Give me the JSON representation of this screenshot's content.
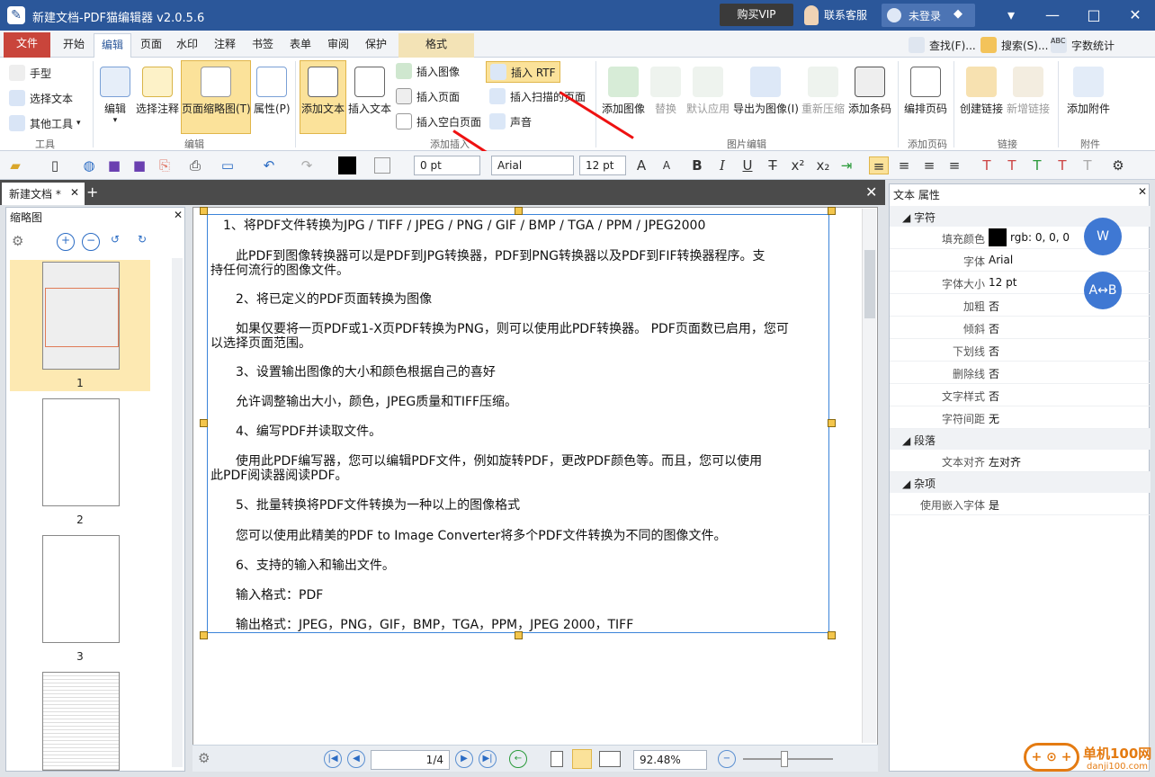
{
  "titlebar": {
    "title": "新建文档-PDF猫编辑器 v2.0.5.6",
    "vip_button": "购买VIP",
    "service": "联系客服",
    "login": "未登录"
  },
  "menu_tabs": [
    "文件",
    "开始",
    "编辑",
    "页面",
    "水印",
    "注释",
    "书签",
    "表单",
    "审阅",
    "保护",
    "格式"
  ],
  "right_tools": {
    "find": "查找(F)...",
    "search": "搜索(S)...",
    "wordcount": "字数统计"
  },
  "ribbon": {
    "groups": {
      "tools": "工具",
      "edit": "编辑",
      "add_insert": "添加插入",
      "image_edit": "图片编辑",
      "add_pagenum": "添加页码",
      "link": "链接",
      "attachment": "附件"
    },
    "tools": [
      "手型",
      "选择文本",
      "其他工具"
    ],
    "edit_buttons": [
      "编辑",
      "选择注释",
      "页面缩略图(T)",
      "属性(P)"
    ],
    "add_text": "添加文本",
    "insert_text": "插入文本",
    "insert_small": [
      "插入图像",
      "插入页面",
      "插入空白页面"
    ],
    "insert_rtf": [
      "插入 RTF",
      "插入扫描的页面",
      "声音"
    ],
    "image_buttons": [
      "添加图像",
      "替换",
      "默认应用",
      "导出为图像(I)",
      "重新压缩",
      "添加条码"
    ],
    "pagenum": "编排页码",
    "link_buttons": [
      "创建链接",
      "新增链接"
    ],
    "attach": "添加附件"
  },
  "format_toolbar": {
    "stroke": "0 pt",
    "font": "Arial",
    "size": "12 pt"
  },
  "doc_tab": "新建文档 *",
  "thumbs": {
    "title": "缩略图",
    "pages": [
      "1",
      "2",
      "3"
    ]
  },
  "document": {
    "lines": [
      "1、将PDF文件转换为JPG / TIFF / JPEG / PNG / GIF / BMP / TGA / PPM / JPEG2000",
      "此PDF到图像转换器可以是PDF到JPG转换器，PDF到PNG转换器以及PDF到FIF转换器程序。支",
      "持任何流行的图像文件。",
      "2、将已定义的PDF页面转换为图像",
      "如果仅要将一页PDF或1-X页PDF转换为PNG，则可以使用此PDF转换器。 PDF页面数已启用，您可",
      "以选择页面范围。",
      "3、设置输出图像的大小和颜色根据自己的喜好",
      "允许调整输出大小，颜色，JPEG质量和TIFF压缩。",
      "4、编写PDF并读取文件。",
      "使用此PDF编写器，您可以编辑PDF文件，例如旋转PDF，更改PDF颜色等。而且，您可以使用",
      "此PDF阅读器阅读PDF。",
      "5、批量转换将PDF文件转换为一种以上的图像格式",
      "您可以使用此精美的PDF to Image Converter将多个PDF文件转换为不同的图像文件。",
      "6、支持的输入和输出文件。",
      "输入格式：PDF",
      "输出格式：JPEG，PNG，GIF，BMP，TGA，PPM，JPEG 2000，TIFF"
    ]
  },
  "navbar": {
    "page": "1",
    "total": "/4",
    "zoom": "92.48%"
  },
  "properties": {
    "title": "文本 属性",
    "sections": {
      "char": "字符",
      "para": "段落",
      "misc": "杂项"
    },
    "rows": [
      {
        "k": "填充颜色",
        "v": "rgb: 0, 0, 0"
      },
      {
        "k": "字体",
        "v": "Arial"
      },
      {
        "k": "字体大小",
        "v": "12 pt"
      },
      {
        "k": "加粗",
        "v": "否"
      },
      {
        "k": "倾斜",
        "v": "否"
      },
      {
        "k": "下划线",
        "v": "否"
      },
      {
        "k": "删除线",
        "v": "否"
      },
      {
        "k": "文字样式",
        "v": "否"
      },
      {
        "k": "字符间距",
        "v": "无"
      }
    ],
    "para_rows": [
      {
        "k": "文本对齐",
        "v": "左对齐"
      }
    ],
    "misc_rows": [
      {
        "k": "使用嵌入字体",
        "v": "是"
      }
    ]
  },
  "watermark": {
    "site": "单机100网",
    "url": "danji100.com"
  }
}
